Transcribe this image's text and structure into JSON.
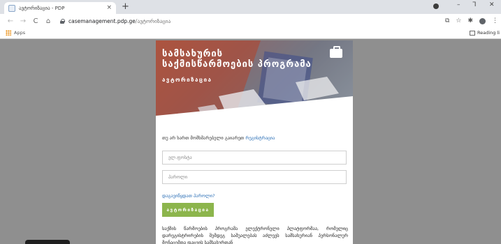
{
  "browser": {
    "tab_title": "ავტორიზაცია - PDP",
    "tab_close_icon": "×",
    "new_tab_icon": "+",
    "url_domain": "casemanagement.pdp.ge",
    "url_path": "/ავტორიზაცია",
    "window_minimize": "–",
    "window_maximize": "ᒣ",
    "window_close": "✕",
    "nav": {
      "back": "←",
      "forward": "→",
      "reload": "C",
      "home": "⌂"
    },
    "toolbar_icons": {
      "translate": "⧉",
      "star": "☆",
      "extensions": "✱",
      "menu": "⋮"
    },
    "bookmarks": {
      "apps_label": "Apps",
      "reading_list_label": "Reading li"
    }
  },
  "hero": {
    "title_line1": "სამსახურის",
    "title_line2": "საქმისწარმოების პროგრამა",
    "subtitle": "ავტორიზაცია"
  },
  "login": {
    "register_prompt": "თუ არ ხართ მომხმარებელი გაიარეთ",
    "register_link": "რეგისტრაცია",
    "email_placeholder": "ელ.ფოსტა",
    "password_placeholder": "პაროლი",
    "forgot_password": "დაგავიწყდათ პაროლი?",
    "submit_label": "ავტორიზაცია",
    "info_text": "საქმის წარმოების პროგრამა ელექტრონული პლატფორმაა, რომელიც დარეგისტრირების შემდეგ საშუალებას აძლევს სამსახურიან პერსონალურ მონაცემთა დაცვის სამსახურთან"
  },
  "colors": {
    "page_background": "#8f8f8f",
    "button_green": "#8cb54c",
    "link_blue": "#2b6fb6",
    "hero_tint": "#a85a45"
  }
}
